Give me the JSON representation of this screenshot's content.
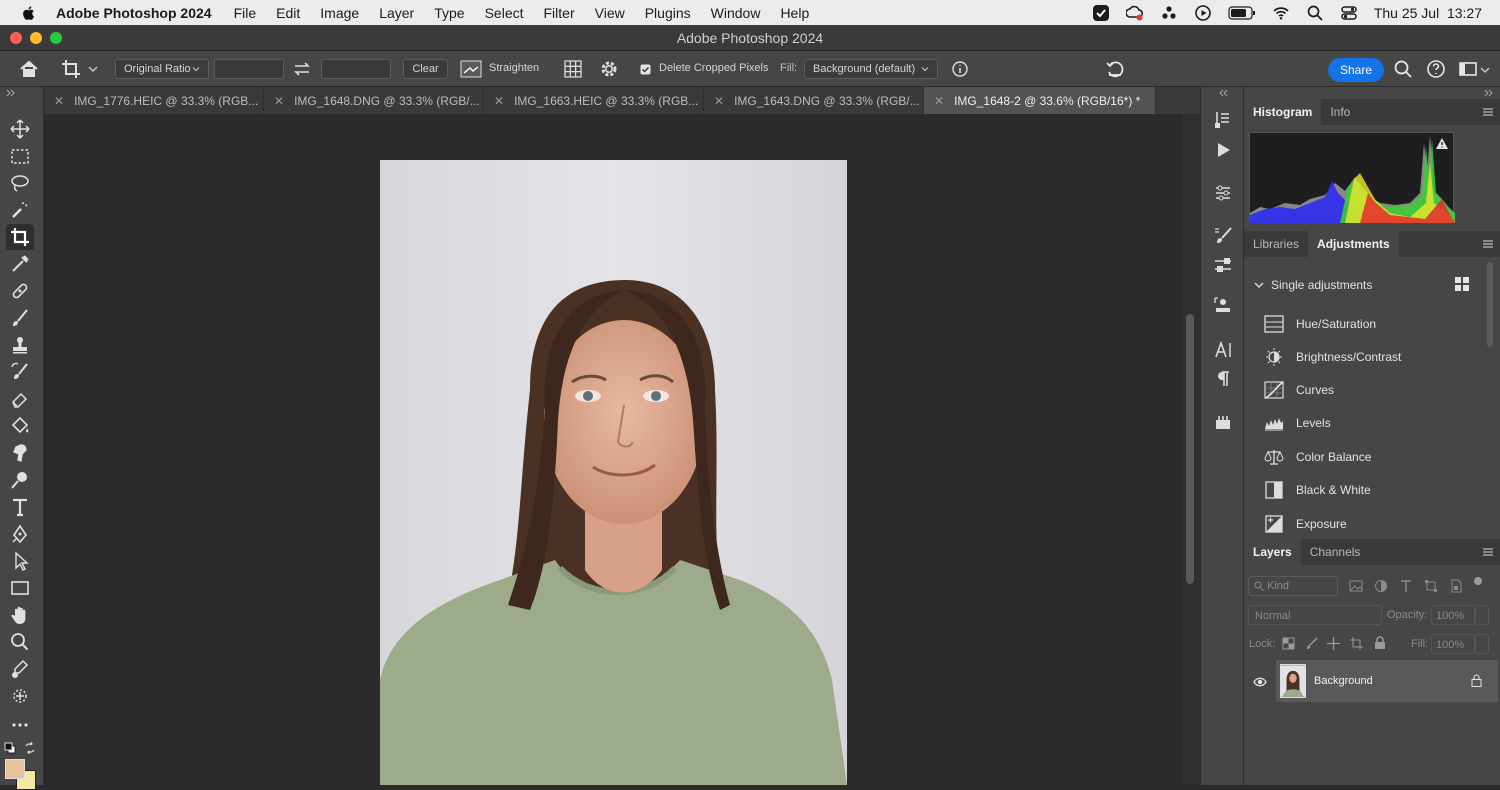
{
  "menubar": {
    "app_name": "Adobe Photoshop 2024",
    "items": [
      "File",
      "Edit",
      "Image",
      "Layer",
      "Type",
      "Select",
      "Filter",
      "View",
      "Plugins",
      "Window",
      "Help"
    ],
    "clock": "Thu 25 Jul  13:27"
  },
  "window": {
    "title": "Adobe Photoshop 2024"
  },
  "options": {
    "ratio": "Original Ratio",
    "clear": "Clear",
    "straighten": "Straighten",
    "delete_cropped": "Delete Cropped Pixels",
    "fill_label": "Fill:",
    "fill_value": "Background (default)",
    "share": "Share"
  },
  "tabs": [
    {
      "label": "IMG_1776.HEIC @ 33.3% (RGB..."
    },
    {
      "label": "IMG_1648.DNG @ 33.3% (RGB/..."
    },
    {
      "label": "IMG_1663.HEIC @ 33.3% (RGB..."
    },
    {
      "label": "IMG_1643.DNG @ 33.3% (RGB/..."
    },
    {
      "label": "IMG_1648-2 @ 33.6% (RGB/16*) *"
    }
  ],
  "panels": {
    "histogram_tab": "Histogram",
    "info_tab": "Info",
    "libraries_tab": "Libraries",
    "adjustments_tab": "Adjustments",
    "single_adjustments": "Single adjustments",
    "adjustments": [
      "Hue/Saturation",
      "Brightness/Contrast",
      "Curves",
      "Levels",
      "Color Balance",
      "Black & White",
      "Exposure"
    ],
    "layers_tab": "Layers",
    "channels_tab": "Channels",
    "kind_placeholder": "Kind",
    "blend_mode": "Normal",
    "opacity_label": "Opacity:",
    "opacity_value": "100%",
    "lock_label": "Lock:",
    "fill_label": "Fill:",
    "fill_value": "100%",
    "layer_name": "Background"
  },
  "colors": {
    "accent": "#1473e6",
    "foreground_swatch": "#e8c29b",
    "background_swatch": "#f3e9a3"
  }
}
